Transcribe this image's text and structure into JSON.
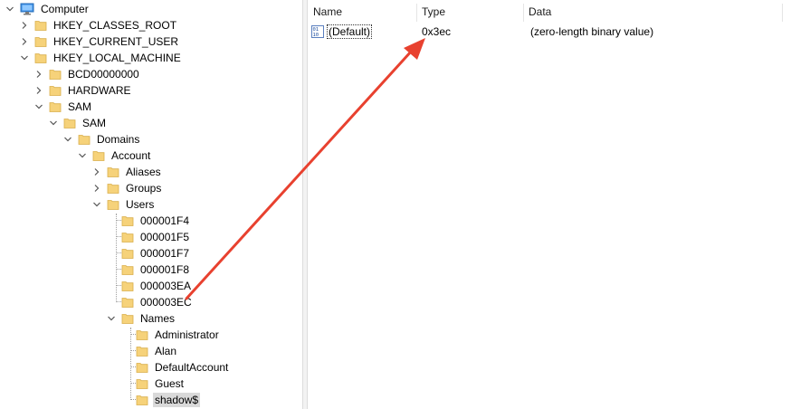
{
  "tree": {
    "root": "Computer",
    "hkcr": "HKEY_CLASSES_ROOT",
    "hkcu": "HKEY_CURRENT_USER",
    "hklm": "HKEY_LOCAL_MACHINE",
    "bcd": "BCD00000000",
    "hardware": "HARDWARE",
    "sam_top": "SAM",
    "sam_inner": "SAM",
    "domains": "Domains",
    "account": "Account",
    "aliases": "Aliases",
    "groups": "Groups",
    "users": "Users",
    "user_keys": [
      "000001F4",
      "000001F5",
      "000001F7",
      "000001F8",
      "000003EA",
      "000003EC"
    ],
    "names": "Names",
    "name_keys": [
      "Administrator",
      "Alan",
      "DefaultAccount",
      "Guest",
      "shadow$"
    ],
    "selected": "shadow$"
  },
  "list": {
    "headers": {
      "name": "Name",
      "type": "Type",
      "data": "Data"
    },
    "rows": [
      {
        "name": "(Default)",
        "type": "0x3ec",
        "data": "(zero-length binary value)",
        "icon": "binary-value-icon"
      }
    ]
  },
  "annotation": {
    "color": "#e8412f",
    "icon": "red-arrow"
  }
}
